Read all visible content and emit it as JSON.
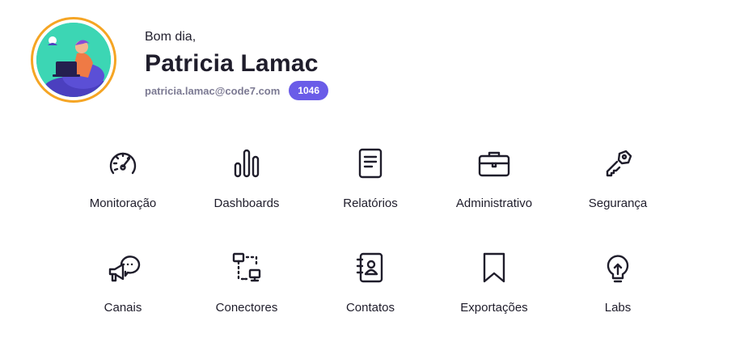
{
  "user": {
    "greeting": "Bom dia,",
    "name": "Patricia Lamac",
    "email": "patricia.lamac@code7.com",
    "badge": "1046"
  },
  "colors": {
    "accent": "#6a5ce8",
    "avatar_ring": "#f5a524",
    "avatar_bg": "#3cd6b4",
    "text": "#1f1d2b",
    "muted": "#7c7a93"
  },
  "menu": {
    "items": [
      {
        "label": "Monitoração",
        "icon": "speedometer-icon"
      },
      {
        "label": "Dashboards",
        "icon": "bar-chart-icon"
      },
      {
        "label": "Relatórios",
        "icon": "document-icon"
      },
      {
        "label": "Administrativo",
        "icon": "briefcase-icon"
      },
      {
        "label": "Segurança",
        "icon": "key-icon"
      },
      {
        "label": "Canais",
        "icon": "megaphone-chat-icon"
      },
      {
        "label": "Conectores",
        "icon": "connector-icon"
      },
      {
        "label": "Contatos",
        "icon": "contact-book-icon"
      },
      {
        "label": "Exportações",
        "icon": "bookmark-icon"
      },
      {
        "label": "Labs",
        "icon": "lightbulb-icon"
      }
    ]
  }
}
